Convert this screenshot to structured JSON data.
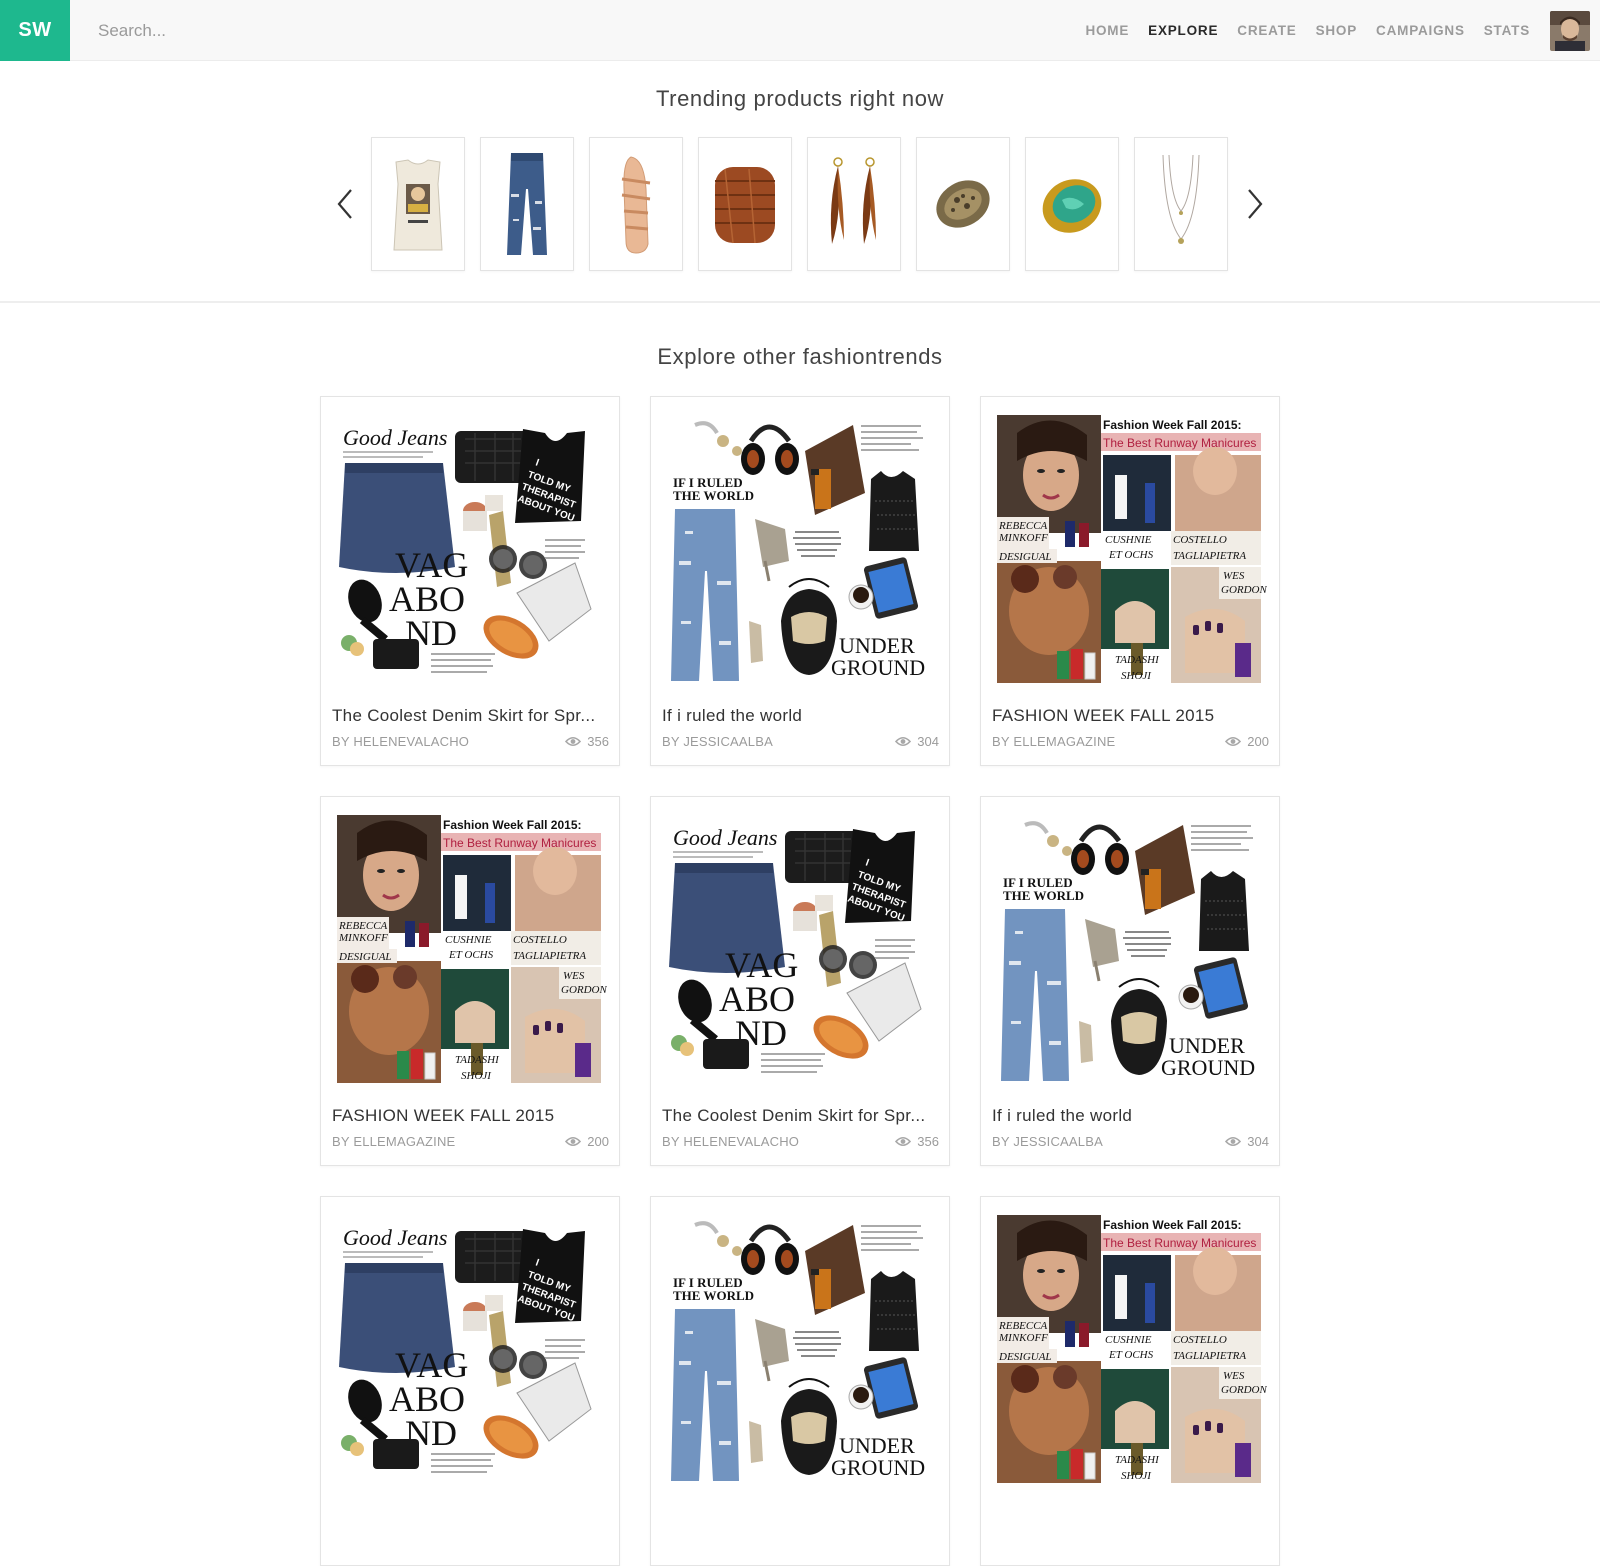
{
  "header": {
    "logo": "SW",
    "search_placeholder": "Search...",
    "nav": [
      {
        "label": "HOME",
        "active": false
      },
      {
        "label": "EXPLORE",
        "active": true
      },
      {
        "label": "CREATE",
        "active": false
      },
      {
        "label": "SHOP",
        "active": false
      },
      {
        "label": "CAMPAIGNS",
        "active": false
      },
      {
        "label": "STATS",
        "active": false
      }
    ],
    "avatar_icon": "user-avatar"
  },
  "trending": {
    "title": "Trending products right now",
    "prev_icon": "chevron-left-icon",
    "next_icon": "chevron-right-icon",
    "products": [
      {
        "name": "graphic-tank-top"
      },
      {
        "name": "ripped-jeans"
      },
      {
        "name": "strappy-sandal"
      },
      {
        "name": "leather-wrap-bracelet"
      },
      {
        "name": "feather-earrings"
      },
      {
        "name": "filigree-ring"
      },
      {
        "name": "green-stone-ring"
      },
      {
        "name": "layered-necklace"
      }
    ]
  },
  "explore": {
    "title": "Explore other fashiontrends",
    "cards": [
      {
        "variant": "jeans",
        "title": "The Coolest Denim Skirt for Spr...",
        "author": "BY HELENEVALACHO",
        "views": "356"
      },
      {
        "variant": "world",
        "title": "If i ruled the world",
        "author": "BY JESSICAALBA",
        "views": "304"
      },
      {
        "variant": "fashion",
        "title": "FASHION WEEK FALL 2015",
        "author": "BY ELLEMAGAZINE",
        "views": "200"
      },
      {
        "variant": "fashion",
        "title": "FASHION WEEK FALL 2015",
        "author": "BY ELLEMAGAZINE",
        "views": "200"
      },
      {
        "variant": "jeans",
        "title": "The Coolest Denim Skirt for Spr...",
        "author": "BY HELENEVALACHO",
        "views": "356"
      },
      {
        "variant": "world",
        "title": "If i ruled the world",
        "author": "BY JESSICAALBA",
        "views": "304"
      },
      {
        "variant": "jeans",
        "title": "",
        "author": "",
        "views": ""
      },
      {
        "variant": "world",
        "title": "",
        "author": "",
        "views": ""
      },
      {
        "variant": "fashion",
        "title": "",
        "author": "",
        "views": ""
      }
    ],
    "collage_text": {
      "good_jeans": "Good Jeans",
      "vagabond_1": "VAG",
      "vagabond_2": "ABO",
      "vagabond_3": "ND",
      "told_1": "I",
      "told_2": "TOLD MY",
      "told_3": "THERAPIST",
      "told_4": "ABOUT YOU",
      "ruled_1": "IF I RULED",
      "ruled_2": "THE WORLD",
      "underground_1": "UNDER",
      "underground_2": "GROUND",
      "fw_1": "Fashion Week Fall 2015:",
      "fw_2": "The Best Runway Manicures",
      "rebecca_1": "REBECCA",
      "rebecca_2": "MINKOFF",
      "desigual": "DESIGUAL",
      "cushnie_1": "CUSHNIE",
      "cushnie_2": "ET OCHS",
      "costello_1": "COSTELLO",
      "costello_2": "TAGLIAPIETRA",
      "wes_1": "WES",
      "wes_2": "GORDON",
      "tadashi_1": "TADASHI",
      "tadashi_2": "SHOJI"
    }
  }
}
